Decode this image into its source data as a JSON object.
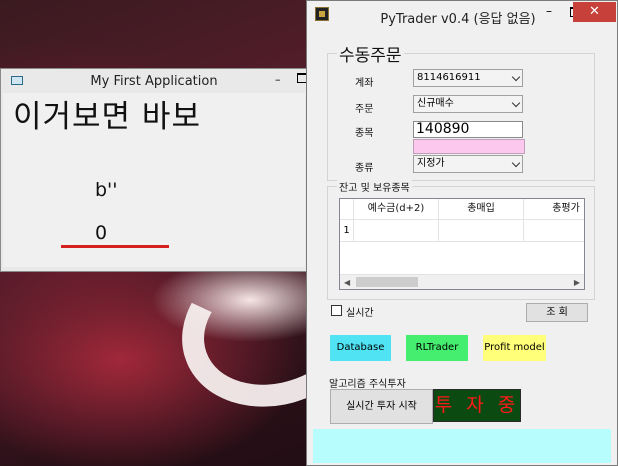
{
  "window1": {
    "title": "My First Application",
    "big_label": "이거보면 바보",
    "bytes_label": "b''",
    "value_label": "0",
    "colors": {
      "underline": "#d42020"
    }
  },
  "window2": {
    "title": "PyTrader v0.4 (응답 없음)",
    "manual_order": {
      "group_title": "수동주문",
      "account_label": "계좌",
      "account_value": "8114616911",
      "order_label": "주문",
      "order_value": "신규매수",
      "stock_label": "종목",
      "stock_value": "140890",
      "type_label": "종류",
      "type_value": "지정가"
    },
    "holdings": {
      "group_title": "잔고 및 보유종목",
      "columns": [
        "예수금(d+2)",
        "총매입",
        "총평가"
      ],
      "row_numbers": [
        "1"
      ]
    },
    "realtime_label": "실시간",
    "inquiry_button": "조 회",
    "buttons": {
      "database": "Database",
      "rltrader": "RLTrader",
      "profit_model": "Profit model"
    },
    "algo_label": "알고리즘 주식투자",
    "start_button": "실시간 투자 시작",
    "investing_label": "투 자 중",
    "colors": {
      "database_bg": "#4fe3f3",
      "rltrader_bg": "#45ee6f",
      "profit_bg": "#ffff7a",
      "investing_bg": "#0b4a10",
      "investing_text": "#ff1a1a",
      "status_bar": "#b8fdfe",
      "stock_code_field": "#fcc8ee",
      "close_button": "#c7403a"
    }
  }
}
